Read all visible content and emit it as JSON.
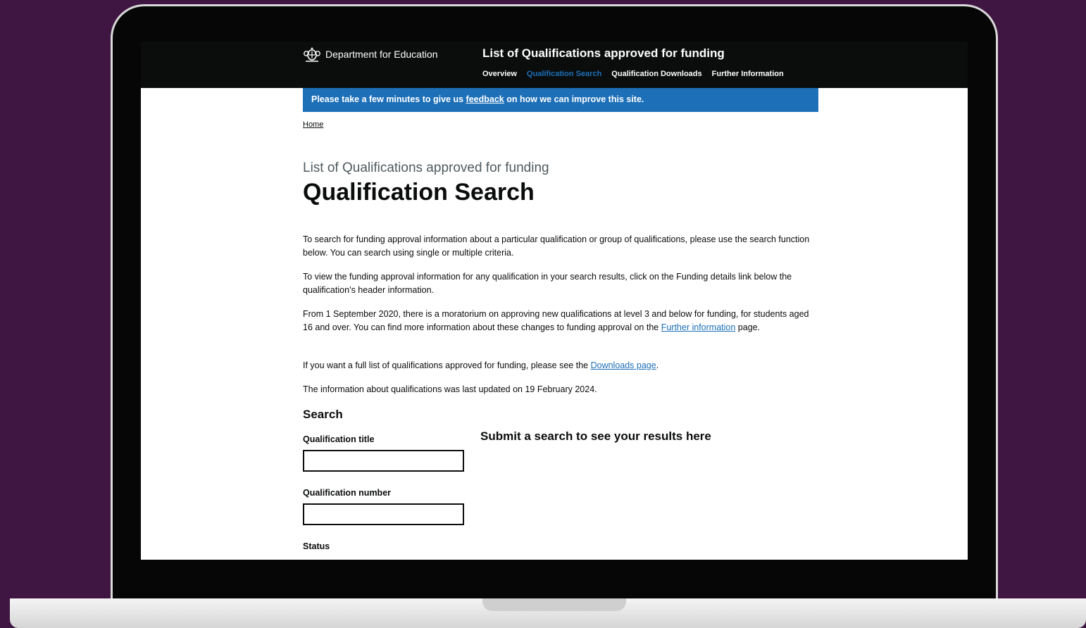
{
  "header": {
    "department": "Department for Education",
    "service_name": "List of Qualifications approved for funding",
    "nav": [
      {
        "label": "Overview",
        "active": false
      },
      {
        "label": "Qualification Search",
        "active": true
      },
      {
        "label": "Qualification Downloads",
        "active": false
      },
      {
        "label": "Further Information",
        "active": false
      }
    ]
  },
  "banner": {
    "before": "Please take a few minutes to give us ",
    "link": "feedback",
    "after": " on how we can improve this site."
  },
  "breadcrumb": {
    "home": "Home"
  },
  "page": {
    "caption": "List of Qualifications approved for funding",
    "title": "Qualification Search"
  },
  "paragraphs": {
    "p1": "To search for funding approval information about a particular qualification or group of qualifications, please use the search function below. You can search using single or multiple criteria.",
    "p2": "To view the funding approval information for any qualification in your search results, click on the Funding details link below the qualification’s header information.",
    "p3_before": "From 1 September 2020, there is a moratorium on approving new qualifications at level 3 and below for funding, for students aged 16 and over. You can find more information about these changes to funding approval on the ",
    "p3_link": "Further information",
    "p3_after": " page.",
    "p4_before": "If you want a full list of qualifications approved for funding, please see the ",
    "p4_link": "Downloads page",
    "p4_after": ".",
    "p5": "The information about qualifications was last updated on 19 February 2024."
  },
  "search": {
    "heading": "Search",
    "title_label": "Qualification title",
    "title_value": "",
    "number_label": "Qualification number",
    "number_value": "",
    "status_label": "Status"
  },
  "results": {
    "message": "Submit a search to see your results here"
  },
  "colors": {
    "header_bg": "#0b0c0c",
    "link_blue": "#1d70b8",
    "frame_bg": "#3f1541"
  }
}
